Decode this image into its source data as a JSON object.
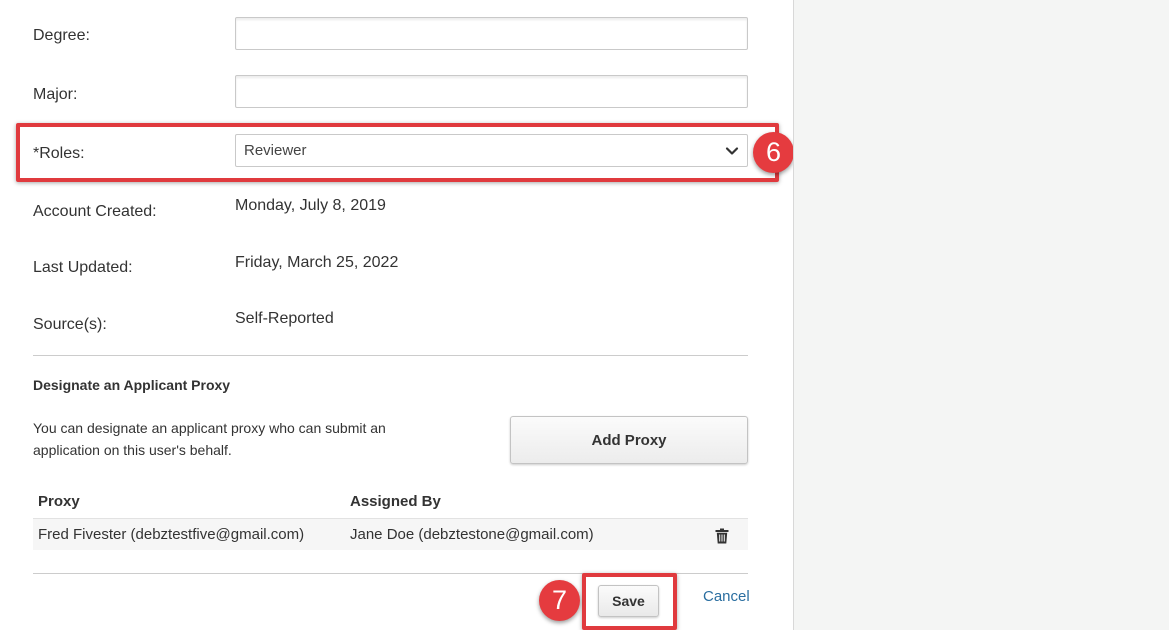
{
  "form": {
    "degree": {
      "label": "Degree:",
      "value": ""
    },
    "major": {
      "label": "Major:",
      "value": ""
    },
    "roles": {
      "label": "*Roles:",
      "selected": "Reviewer"
    },
    "account_created": {
      "label": "Account Created:",
      "value": "Monday, July 8, 2019"
    },
    "last_updated": {
      "label": "Last Updated:",
      "value": "Friday, March 25, 2022"
    },
    "sources": {
      "label": "Source(s):",
      "value": "Self-Reported"
    }
  },
  "proxy_section": {
    "title": "Designate an Applicant Proxy",
    "description": "You can designate an applicant proxy who can submit an application on this user's behalf.",
    "add_button": "Add Proxy",
    "table": {
      "headers": {
        "proxy": "Proxy",
        "assigned_by": "Assigned By"
      },
      "rows": [
        {
          "proxy": "Fred Fivester (debztestfive@gmail.com)",
          "assigned_by": "Jane Doe (debztestone@gmail.com)",
          "action_icon": "trash-icon"
        }
      ]
    }
  },
  "actions": {
    "save": "Save",
    "cancel": "Cancel"
  },
  "callouts": {
    "roles_step": "6",
    "save_step": "7"
  },
  "colors": {
    "highlight": "#e03a3e",
    "link": "#2a6ea0",
    "sidebar": "#f4f5f4"
  }
}
